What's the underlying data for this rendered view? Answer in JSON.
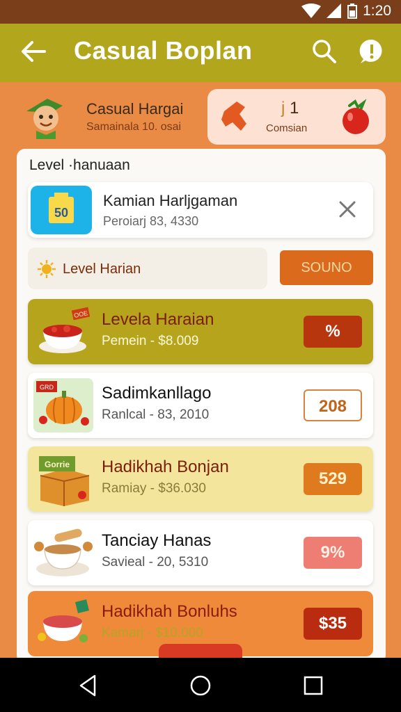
{
  "status_bar": {
    "time": "1:20"
  },
  "app_bar": {
    "title": "Casual Boplan"
  },
  "profile": {
    "name": "Casual Hargai",
    "subtitle": "Samainala 10. osai"
  },
  "reward": {
    "count": "1",
    "label": "Comsian"
  },
  "panel": {
    "heading": "Level ·hanuaan",
    "feature": {
      "title": "Kamian Harljgaman",
      "subtitle": "Peroiarj 83, 4330",
      "thumb_text": "50"
    },
    "level_row": {
      "label": "Level Harian"
    },
    "sound_button": "SOUNO"
  },
  "items": [
    {
      "title": "Levela Haraian",
      "subtitle": "Pemein - $8.009",
      "price": "%",
      "badge": "OOE"
    },
    {
      "title": "Sadimkanllago",
      "subtitle": "Ranlcal - 83, 2010",
      "price": "208",
      "badge": "GRD"
    },
    {
      "title": "Hadikhah Bonjan",
      "subtitle": "Ramiay - $36.030",
      "price": "529",
      "badge": "Gorrie"
    },
    {
      "title": "Tanciay Hanas",
      "subtitle": "Savieal - 20, 5310",
      "price": "9%"
    },
    {
      "title": "Hadikhah Bonluhs",
      "subtitle": "Kamarj - $10.000",
      "price": "$35"
    }
  ]
}
